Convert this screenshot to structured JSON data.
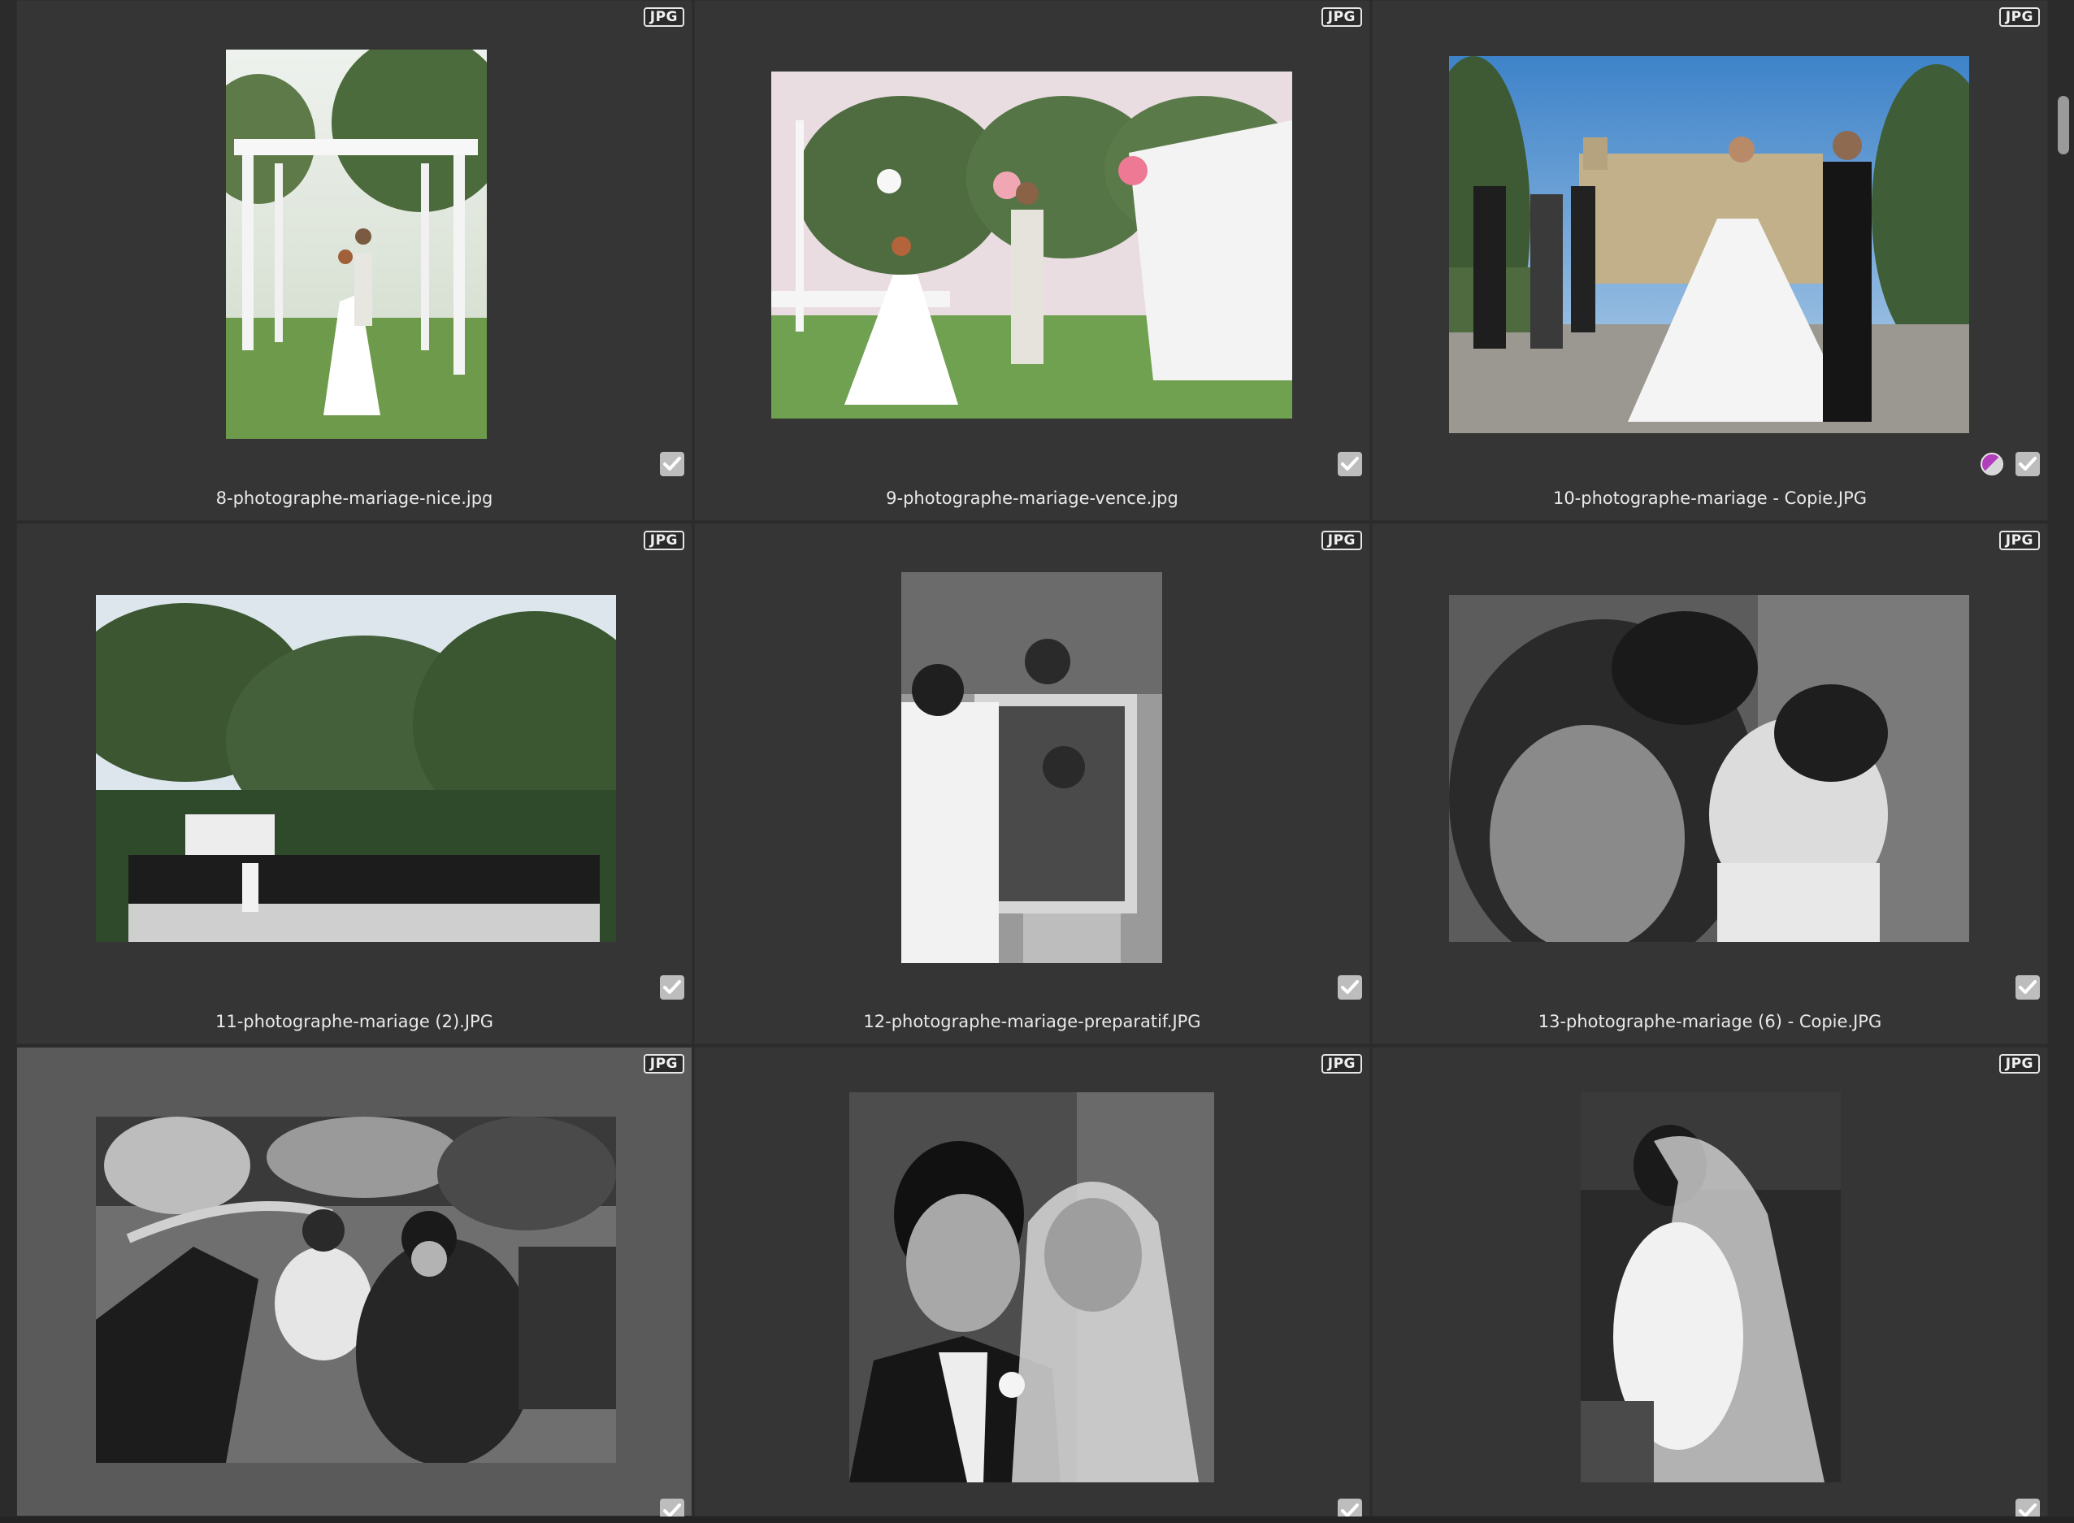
{
  "badge_label": "JPG",
  "colors": {
    "background": "#2b2b2b",
    "cell": "#353535",
    "cell_selected": "#5a5a5a",
    "check": "#bdbdbd",
    "color_label": "#b13fbd"
  },
  "photos": [
    {
      "filename": "8-photographe-mariage-nice.jpg",
      "badge": "JPG",
      "checked": true,
      "color_label": false,
      "selected": false
    },
    {
      "filename": "9-photographe-mariage-vence.jpg",
      "badge": "JPG",
      "checked": true,
      "color_label": false,
      "selected": false
    },
    {
      "filename": "10-photographe-mariage - Copie.JPG",
      "badge": "JPG",
      "checked": true,
      "color_label": true,
      "selected": false
    },
    {
      "filename": "11-photographe-mariage (2).JPG",
      "badge": "JPG",
      "checked": true,
      "color_label": false,
      "selected": false
    },
    {
      "filename": "12-photographe-mariage-preparatif.JPG",
      "badge": "JPG",
      "checked": true,
      "color_label": false,
      "selected": false
    },
    {
      "filename": "13-photographe-mariage (6) - Copie.JPG",
      "badge": "JPG",
      "checked": true,
      "color_label": false,
      "selected": false
    },
    {
      "filename": "",
      "badge": "JPG",
      "checked": true,
      "color_label": false,
      "selected": true
    },
    {
      "filename": "",
      "badge": "JPG",
      "checked": true,
      "color_label": false,
      "selected": false
    },
    {
      "filename": "",
      "badge": "JPG",
      "checked": true,
      "color_label": false,
      "selected": false
    }
  ],
  "icons": {
    "check": "checkmark-icon",
    "color_label": "color-label-icon"
  }
}
